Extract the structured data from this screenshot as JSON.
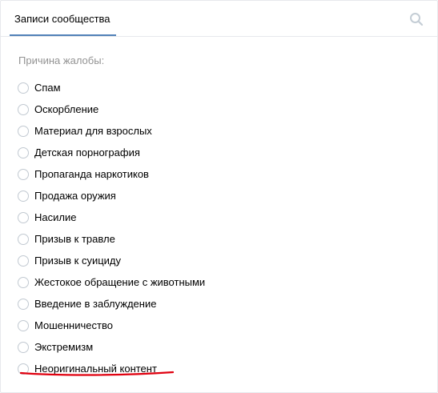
{
  "header": {
    "tab_label": "Записи сообщества",
    "search_icon": "search-icon"
  },
  "report": {
    "title": "Причина жалобы:",
    "options": [
      {
        "label": "Спам",
        "selected": false
      },
      {
        "label": "Оскорбление",
        "selected": false
      },
      {
        "label": "Материал для взрослых",
        "selected": false
      },
      {
        "label": "Детская порнография",
        "selected": false
      },
      {
        "label": "Пропаганда наркотиков",
        "selected": false
      },
      {
        "label": "Продажа оружия",
        "selected": false
      },
      {
        "label": "Насилие",
        "selected": false
      },
      {
        "label": "Призыв к травле",
        "selected": false
      },
      {
        "label": "Призыв к суициду",
        "selected": false
      },
      {
        "label": "Жестокое обращение с животными",
        "selected": false
      },
      {
        "label": "Введение в заблуждение",
        "selected": false
      },
      {
        "label": "Мошенничество",
        "selected": false
      },
      {
        "label": "Экстремизм",
        "selected": false
      },
      {
        "label": "Неоригинальный контент",
        "selected": false
      }
    ]
  },
  "colors": {
    "accent": "#5181b8",
    "muted_text": "#939393",
    "border": "#e7e8ec",
    "radio_border": "#c1c9d1",
    "annotation": "#e0000f"
  }
}
